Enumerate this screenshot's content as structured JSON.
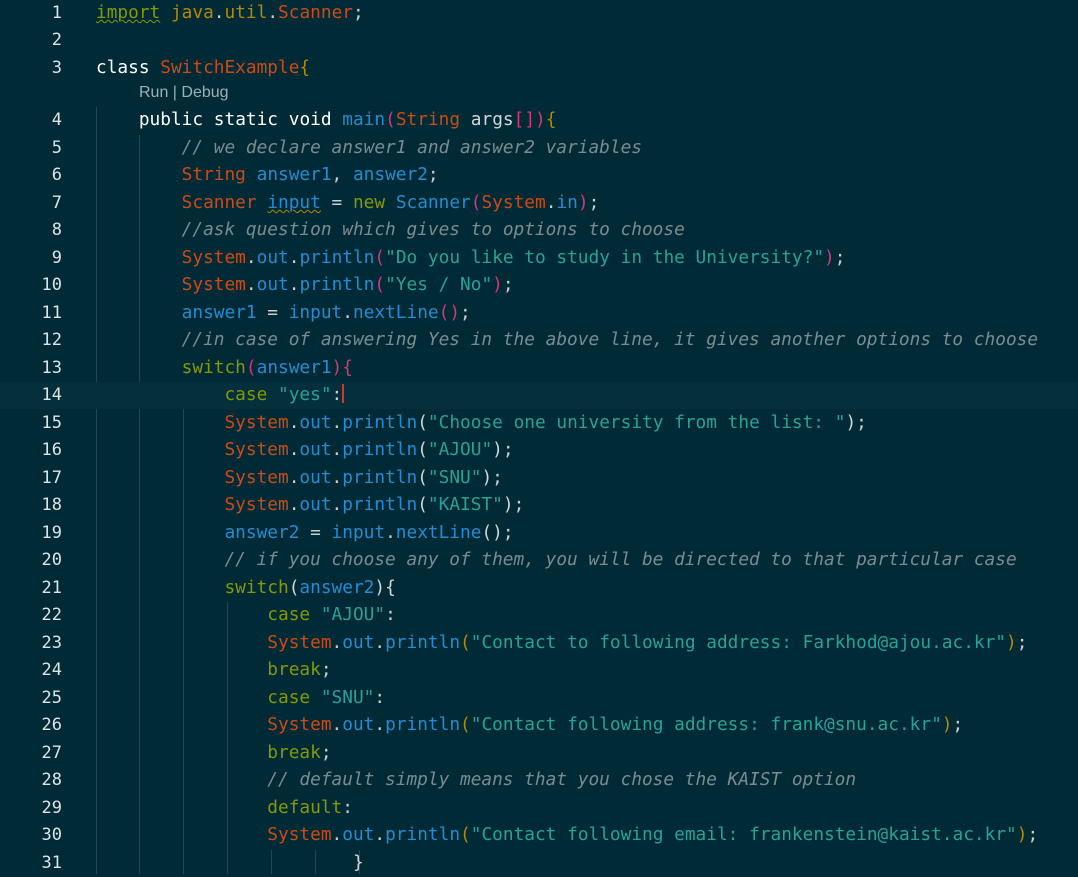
{
  "editor": {
    "codelens": {
      "run": "Run",
      "sep": " | ",
      "debug": "Debug"
    },
    "current_line": 14,
    "lines": [
      {
        "n": "1",
        "tokens": [
          {
            "t": "import",
            "c": "kw",
            "sq": "sq"
          },
          {
            "t": " "
          },
          {
            "t": "java",
            "c": "pk"
          },
          {
            "t": ".",
            "c": "pn"
          },
          {
            "t": "util",
            "c": "pk"
          },
          {
            "t": ".",
            "c": "pn"
          },
          {
            "t": "Scanner",
            "c": "ty"
          },
          {
            "t": ";",
            "c": "pn"
          }
        ]
      },
      {
        "n": "2",
        "tokens": []
      },
      {
        "n": "3",
        "tokens": [
          {
            "t": "class",
            "c": "kwb"
          },
          {
            "t": " "
          },
          {
            "t": "SwitchExample",
            "c": "ty"
          },
          {
            "t": "{",
            "c": "by"
          }
        ]
      },
      {
        "n": "4",
        "tokens": [
          {
            "t": "    "
          },
          {
            "t": "public",
            "c": "kwb"
          },
          {
            "t": " "
          },
          {
            "t": "static",
            "c": "kwb"
          },
          {
            "t": " "
          },
          {
            "t": "void",
            "c": "kwb"
          },
          {
            "t": " "
          },
          {
            "t": "main",
            "c": "fn"
          },
          {
            "t": "(",
            "c": "br"
          },
          {
            "t": "String",
            "c": "ty"
          },
          {
            "t": " "
          },
          {
            "t": "args",
            "c": "pl"
          },
          {
            "t": "[]",
            "c": "br"
          },
          {
            "t": ")",
            "c": "br"
          },
          {
            "t": "{",
            "c": "by"
          }
        ]
      },
      {
        "n": "5",
        "tokens": [
          {
            "t": "        "
          },
          {
            "t": "// we declare answer1 and answer2 variables",
            "c": "cm"
          }
        ]
      },
      {
        "n": "6",
        "tokens": [
          {
            "t": "        "
          },
          {
            "t": "String",
            "c": "ty"
          },
          {
            "t": " "
          },
          {
            "t": "answer1",
            "c": "va"
          },
          {
            "t": ", ",
            "c": "pn"
          },
          {
            "t": "answer2",
            "c": "va"
          },
          {
            "t": ";",
            "c": "pn"
          }
        ]
      },
      {
        "n": "7",
        "tokens": [
          {
            "t": "        "
          },
          {
            "t": "Scanner",
            "c": "ty"
          },
          {
            "t": " "
          },
          {
            "t": "input",
            "c": "va",
            "sq": "sqi"
          },
          {
            "t": " = ",
            "c": "pn"
          },
          {
            "t": "new",
            "c": "kw"
          },
          {
            "t": " "
          },
          {
            "t": "Scanner",
            "c": "fn"
          },
          {
            "t": "(",
            "c": "br"
          },
          {
            "t": "System",
            "c": "ty"
          },
          {
            "t": ".",
            "c": "pn"
          },
          {
            "t": "in",
            "c": "fn"
          },
          {
            "t": ")",
            "c": "br"
          },
          {
            "t": ";",
            "c": "pn"
          }
        ]
      },
      {
        "n": "8",
        "tokens": [
          {
            "t": "        "
          },
          {
            "t": "//ask question which gives to options to choose",
            "c": "cm"
          }
        ]
      },
      {
        "n": "9",
        "tokens": [
          {
            "t": "        "
          },
          {
            "t": "System",
            "c": "ty"
          },
          {
            "t": ".",
            "c": "pn"
          },
          {
            "t": "out",
            "c": "fn"
          },
          {
            "t": ".",
            "c": "pn"
          },
          {
            "t": "println",
            "c": "fn"
          },
          {
            "t": "(",
            "c": "br"
          },
          {
            "t": "\"Do you like to study in the University?\"",
            "c": "st"
          },
          {
            "t": ")",
            "c": "br"
          },
          {
            "t": ";",
            "c": "pn"
          }
        ]
      },
      {
        "n": "10",
        "tokens": [
          {
            "t": "        "
          },
          {
            "t": "System",
            "c": "ty"
          },
          {
            "t": ".",
            "c": "pn"
          },
          {
            "t": "out",
            "c": "fn"
          },
          {
            "t": ".",
            "c": "pn"
          },
          {
            "t": "println",
            "c": "fn"
          },
          {
            "t": "(",
            "c": "br"
          },
          {
            "t": "\"Yes / No\"",
            "c": "st"
          },
          {
            "t": ")",
            "c": "br"
          },
          {
            "t": ";",
            "c": "pn"
          }
        ]
      },
      {
        "n": "11",
        "tokens": [
          {
            "t": "        "
          },
          {
            "t": "answer1",
            "c": "va"
          },
          {
            "t": " = ",
            "c": "pn"
          },
          {
            "t": "input",
            "c": "va"
          },
          {
            "t": ".",
            "c": "pn"
          },
          {
            "t": "nextLine",
            "c": "fn"
          },
          {
            "t": "()",
            "c": "br"
          },
          {
            "t": ";",
            "c": "pn"
          }
        ]
      },
      {
        "n": "12",
        "tokens": [
          {
            "t": "        "
          },
          {
            "t": "//in case of answering Yes in the above line, it gives another options to choose",
            "c": "cm"
          }
        ]
      },
      {
        "n": "13",
        "tokens": [
          {
            "t": "        "
          },
          {
            "t": "switch",
            "c": "kw"
          },
          {
            "t": "(",
            "c": "br"
          },
          {
            "t": "answer1",
            "c": "va"
          },
          {
            "t": ")",
            "c": "br"
          },
          {
            "t": "{",
            "c": "br"
          }
        ]
      },
      {
        "n": "14",
        "tokens": [
          {
            "t": "            "
          },
          {
            "t": "case",
            "c": "kw"
          },
          {
            "t": " "
          },
          {
            "t": "\"yes\"",
            "c": "st"
          },
          {
            "t": ":",
            "c": "pn"
          }
        ],
        "caret": true
      },
      {
        "n": "15",
        "tokens": [
          {
            "t": "            "
          },
          {
            "t": "System",
            "c": "ty"
          },
          {
            "t": ".",
            "c": "pn"
          },
          {
            "t": "out",
            "c": "fn"
          },
          {
            "t": ".",
            "c": "pn"
          },
          {
            "t": "println",
            "c": "fn"
          },
          {
            "t": "(",
            "c": "pl"
          },
          {
            "t": "\"Choose one university from the list: \"",
            "c": "st"
          },
          {
            "t": ")",
            "c": "pl"
          },
          {
            "t": ";",
            "c": "pn"
          }
        ]
      },
      {
        "n": "16",
        "tokens": [
          {
            "t": "            "
          },
          {
            "t": "System",
            "c": "ty"
          },
          {
            "t": ".",
            "c": "pn"
          },
          {
            "t": "out",
            "c": "fn"
          },
          {
            "t": ".",
            "c": "pn"
          },
          {
            "t": "println",
            "c": "fn"
          },
          {
            "t": "(",
            "c": "pl"
          },
          {
            "t": "\"AJOU\"",
            "c": "st"
          },
          {
            "t": ")",
            "c": "pl"
          },
          {
            "t": ";",
            "c": "pn"
          }
        ]
      },
      {
        "n": "17",
        "tokens": [
          {
            "t": "            "
          },
          {
            "t": "System",
            "c": "ty"
          },
          {
            "t": ".",
            "c": "pn"
          },
          {
            "t": "out",
            "c": "fn"
          },
          {
            "t": ".",
            "c": "pn"
          },
          {
            "t": "println",
            "c": "fn"
          },
          {
            "t": "(",
            "c": "pl"
          },
          {
            "t": "\"SNU\"",
            "c": "st"
          },
          {
            "t": ")",
            "c": "pl"
          },
          {
            "t": ";",
            "c": "pn"
          }
        ]
      },
      {
        "n": "18",
        "tokens": [
          {
            "t": "            "
          },
          {
            "t": "System",
            "c": "ty"
          },
          {
            "t": ".",
            "c": "pn"
          },
          {
            "t": "out",
            "c": "fn"
          },
          {
            "t": ".",
            "c": "pn"
          },
          {
            "t": "println",
            "c": "fn"
          },
          {
            "t": "(",
            "c": "pl"
          },
          {
            "t": "\"KAIST\"",
            "c": "st"
          },
          {
            "t": ")",
            "c": "pl"
          },
          {
            "t": ";",
            "c": "pn"
          }
        ]
      },
      {
        "n": "19",
        "tokens": [
          {
            "t": "            "
          },
          {
            "t": "answer2",
            "c": "va"
          },
          {
            "t": " = ",
            "c": "pn"
          },
          {
            "t": "input",
            "c": "va"
          },
          {
            "t": ".",
            "c": "pn"
          },
          {
            "t": "nextLine",
            "c": "fn"
          },
          {
            "t": "()",
            "c": "pl"
          },
          {
            "t": ";",
            "c": "pn"
          }
        ]
      },
      {
        "n": "20",
        "tokens": [
          {
            "t": "            "
          },
          {
            "t": "// if you choose any of them, you will be directed to that particular case",
            "c": "cm"
          }
        ]
      },
      {
        "n": "21",
        "tokens": [
          {
            "t": "            "
          },
          {
            "t": "switch",
            "c": "kw"
          },
          {
            "t": "(",
            "c": "pl"
          },
          {
            "t": "answer2",
            "c": "va"
          },
          {
            "t": ")",
            "c": "pl"
          },
          {
            "t": "{",
            "c": "pl"
          }
        ]
      },
      {
        "n": "22",
        "tokens": [
          {
            "t": "                "
          },
          {
            "t": "case",
            "c": "kw"
          },
          {
            "t": " "
          },
          {
            "t": "\"AJOU\"",
            "c": "st"
          },
          {
            "t": ":",
            "c": "pn"
          }
        ]
      },
      {
        "n": "23",
        "tokens": [
          {
            "t": "                "
          },
          {
            "t": "System",
            "c": "ty"
          },
          {
            "t": ".",
            "c": "pn"
          },
          {
            "t": "out",
            "c": "fn"
          },
          {
            "t": ".",
            "c": "pn"
          },
          {
            "t": "println",
            "c": "fn"
          },
          {
            "t": "(",
            "c": "by"
          },
          {
            "t": "\"Contact to following address: Farkhod@ajou.ac.kr\"",
            "c": "st"
          },
          {
            "t": ")",
            "c": "by"
          },
          {
            "t": ";",
            "c": "pn"
          }
        ]
      },
      {
        "n": "24",
        "tokens": [
          {
            "t": "                "
          },
          {
            "t": "break",
            "c": "kw"
          },
          {
            "t": ";",
            "c": "pn"
          }
        ]
      },
      {
        "n": "25",
        "tokens": [
          {
            "t": "                "
          },
          {
            "t": "case",
            "c": "kw"
          },
          {
            "t": " "
          },
          {
            "t": "\"SNU\"",
            "c": "st"
          },
          {
            "t": ":",
            "c": "pn"
          }
        ]
      },
      {
        "n": "26",
        "tokens": [
          {
            "t": "                "
          },
          {
            "t": "System",
            "c": "ty"
          },
          {
            "t": ".",
            "c": "pn"
          },
          {
            "t": "out",
            "c": "fn"
          },
          {
            "t": ".",
            "c": "pn"
          },
          {
            "t": "println",
            "c": "fn"
          },
          {
            "t": "(",
            "c": "by"
          },
          {
            "t": "\"Contact following address: frank@snu.ac.kr\"",
            "c": "st"
          },
          {
            "t": ")",
            "c": "by"
          },
          {
            "t": ";",
            "c": "pn"
          }
        ]
      },
      {
        "n": "27",
        "tokens": [
          {
            "t": "                "
          },
          {
            "t": "break",
            "c": "kw"
          },
          {
            "t": ";",
            "c": "pn"
          }
        ]
      },
      {
        "n": "28",
        "tokens": [
          {
            "t": "                "
          },
          {
            "t": "// default simply means that you chose the KAIST option",
            "c": "cm"
          }
        ]
      },
      {
        "n": "29",
        "tokens": [
          {
            "t": "                "
          },
          {
            "t": "default",
            "c": "kw"
          },
          {
            "t": ":",
            "c": "pn"
          }
        ]
      },
      {
        "n": "30",
        "tokens": [
          {
            "t": "                "
          },
          {
            "t": "System",
            "c": "ty"
          },
          {
            "t": ".",
            "c": "pn"
          },
          {
            "t": "out",
            "c": "fn"
          },
          {
            "t": ".",
            "c": "pn"
          },
          {
            "t": "println",
            "c": "fn"
          },
          {
            "t": "(",
            "c": "by"
          },
          {
            "t": "\"Contact following email: frankenstein@kaist.ac.kr\"",
            "c": "st"
          },
          {
            "t": ")",
            "c": "by"
          },
          {
            "t": ";",
            "c": "pn"
          }
        ]
      },
      {
        "n": "31",
        "tokens": [
          {
            "t": "                        "
          },
          {
            "t": "}",
            "c": "pl"
          }
        ]
      }
    ]
  },
  "colors": {
    "background": "#002b36",
    "current_line": "#04303b",
    "keyword": "#859900",
    "type": "#cb4b16",
    "function": "#268bd2",
    "string": "#2aa198",
    "comment": "#7b8c8f",
    "bracket": "#d33682",
    "brace": "#b58900"
  },
  "icons": {
    "lightbulb": "lightbulb-icon"
  }
}
